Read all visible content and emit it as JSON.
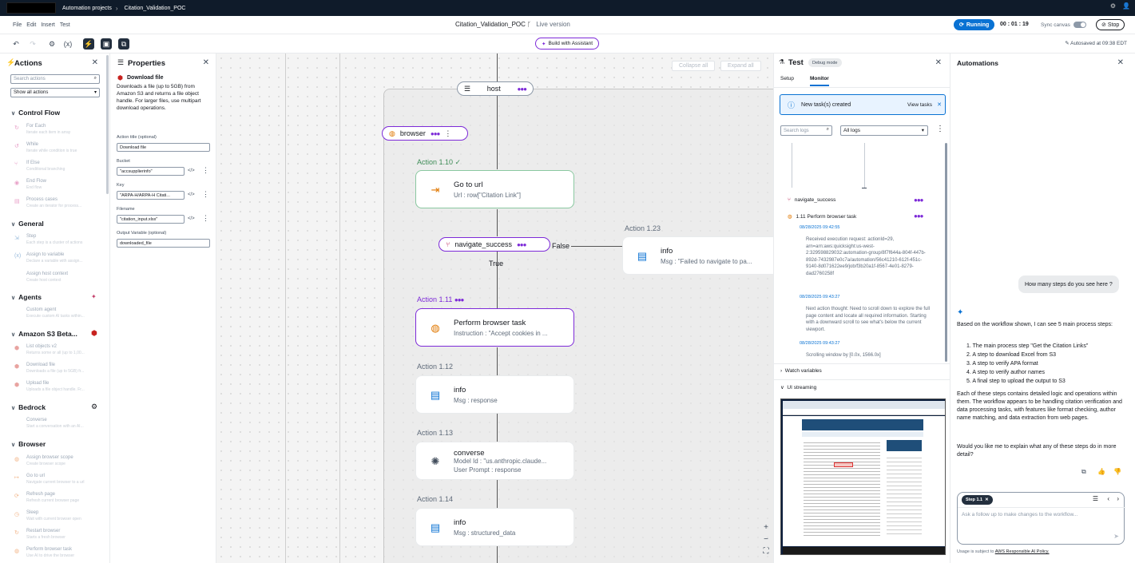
{
  "topbar": {
    "crumb1": "Automation projects",
    "crumb2": "Citation_Validation_POC"
  },
  "secondbar": {
    "menu": [
      "File",
      "Edit",
      "Insert",
      "Test"
    ],
    "title": "Citation_Validation_POC",
    "live": "Live version",
    "running": "Running",
    "timer": "00 : 01 : 19",
    "sync": "Sync canvas",
    "stop": "Stop"
  },
  "toolbar": {
    "assistant": "Build with Assistant",
    "autosave": "Autosaved at 09:38 EDT"
  },
  "actions_panel": {
    "title": "Actions",
    "search_placeholder": "Search actions",
    "select": "Show all actions",
    "sections": [
      {
        "name": "Control Flow",
        "items": [
          {
            "name": "For Each",
            "desc": "Iterate each item in array"
          },
          {
            "name": "While",
            "desc": "Iterate while condition is true"
          },
          {
            "name": "If Else",
            "desc": "Conditional branching"
          },
          {
            "name": "End Flow",
            "desc": "End flow"
          },
          {
            "name": "Process cases",
            "desc": "Create an iterator for process..."
          }
        ]
      },
      {
        "name": "General",
        "items": [
          {
            "name": "Step",
            "desc": "Each step is a cluster of actions"
          },
          {
            "name": "Assign to variable",
            "desc": "Declare a variable with assign..."
          },
          {
            "name": "Assign host context",
            "desc": "Create host context"
          }
        ]
      },
      {
        "name": "Agents",
        "items": [
          {
            "name": "Custom agent",
            "desc": "Execute custom AI tasks within..."
          }
        ]
      },
      {
        "name": "Amazon S3 Beta...",
        "items": [
          {
            "name": "List objects v2",
            "desc": "Returns some or all (up to 1,00..."
          },
          {
            "name": "Download file",
            "desc": "Downloads a file (up to 5GB) fr..."
          },
          {
            "name": "Upload file",
            "desc": "Uploads a file object handle. Fr..."
          }
        ]
      },
      {
        "name": "Bedrock",
        "items": [
          {
            "name": "Converse",
            "desc": "Start a conversation with an AI..."
          }
        ]
      },
      {
        "name": "Browser",
        "items": [
          {
            "name": "Assign browser scope",
            "desc": "Create browser scope"
          },
          {
            "name": "Go to url",
            "desc": "Navigate current browser to a url"
          },
          {
            "name": "Refresh page",
            "desc": "Refresh current browser page"
          },
          {
            "name": "Sleep",
            "desc": "Wait with current browser open"
          },
          {
            "name": "Restart browser",
            "desc": "Starts a fresh browser"
          },
          {
            "name": "Perform browser task",
            "desc": "Use AI to drive the browser"
          }
        ]
      }
    ]
  },
  "properties": {
    "title": "Properties",
    "action_name": "Download file",
    "description": "Downloads a file (up to 5GB) from Amazon S3 and returns a file object handle. For larger files, use multipart download operations.",
    "fields": [
      {
        "label": "Action title (optional)",
        "value": "Download file"
      },
      {
        "label": "Bucket",
        "value": "\"accsupplierinfo\""
      },
      {
        "label": "Key",
        "value": "\"ARPA-H/ARPA-H Citati..."
      },
      {
        "label": "Filename",
        "value": "\"citation_input.xlsx\""
      },
      {
        "label": "Output Variable (optional)",
        "value": "downloaded_file"
      }
    ]
  },
  "canvas": {
    "collapse_all": "Collapse all",
    "expand_all": "Expand all",
    "host": "host",
    "browser": "browser",
    "nodes": [
      {
        "label": "Action 1.10",
        "title": "Go to url",
        "sub": "Url : row[\"Citation Link\"]"
      },
      {
        "label": "Action 1.23",
        "title": "info",
        "sub": "Msg : \"Failed to navigate to pa..."
      },
      {
        "label": "Action 1.11",
        "title": "Perform browser task",
        "sub": "Instruction : \"Accept cookies in ..."
      },
      {
        "label": "Action 1.12",
        "title": "info",
        "sub": "Msg : response"
      },
      {
        "label": "Action 1.13",
        "title": "converse",
        "sub": "Model Id : \"us.anthropic.claude...",
        "sub2": "User Prompt : response"
      },
      {
        "label": "Action 1.14",
        "title": "info",
        "sub": "Msg : structured_data"
      }
    ],
    "condition": "navigate_success",
    "false_label": "False",
    "true_label": "True"
  },
  "test_panel": {
    "title": "Test",
    "badge": "Debug mode",
    "tabs": [
      "Setup",
      "Monitor"
    ],
    "alert": "New task(s) created",
    "view_tasks": "View tasks",
    "search_placeholder": "Search logs",
    "log_filter": "All logs",
    "log_items": [
      {
        "name": "navigate_success"
      },
      {
        "name": "1.11  Perform browser task"
      }
    ],
    "logs": [
      {
        "ts": "08/28/2025 09:42:55",
        "text": "Received execution request: actionId=29, arn=arn:aws:quicksight:us-west-2:329598829032:automation-group/8f7f644a-804f-447b-892d-7432987e0c7a/automation/56c41210-612f-451c-9140-8d071622ee9/job/f3b20a1f-8567-4e01-8279-dad2760258f"
      },
      {
        "ts": "08/28/2025 09:43:27",
        "text": "Next action thought: Need to scroll down to explore the full page content and locate all required information. Starting with a downward scroll to see what's below the current viewport."
      },
      {
        "ts": "08/28/2025 09:43:27",
        "text": "Scrolling window by [0.0x, 1566.0x]"
      }
    ],
    "watch": "Watch variables",
    "ui_streaming": "UI streaming"
  },
  "automations": {
    "title": "Automations",
    "user_msg": "How many steps do you see here ?",
    "intro": "Based on the workflow shown, I can see 5 main process steps:",
    "steps": [
      "1. The main process step \"Get the Citation Links\"",
      "2. A step to download Excel from S3",
      "3. A step to verify APA format",
      "4. A step to verify author names",
      "5. A final step to upload the output to S3"
    ],
    "para": "Each of these steps contains detailed logic and operations within them. The workflow appears to be handling citation verification and data processing tasks, with features like format checking, author name matching, and data extraction from web pages.",
    "question": "Would you like me to explain what any of these steps do in more detail?",
    "chip": "Step 1.1",
    "input_placeholder": "Ask a follow up to make changes to the workflow...",
    "footer": "Usage is subject to",
    "footer_link": "AWS Responsible AI Policy."
  }
}
